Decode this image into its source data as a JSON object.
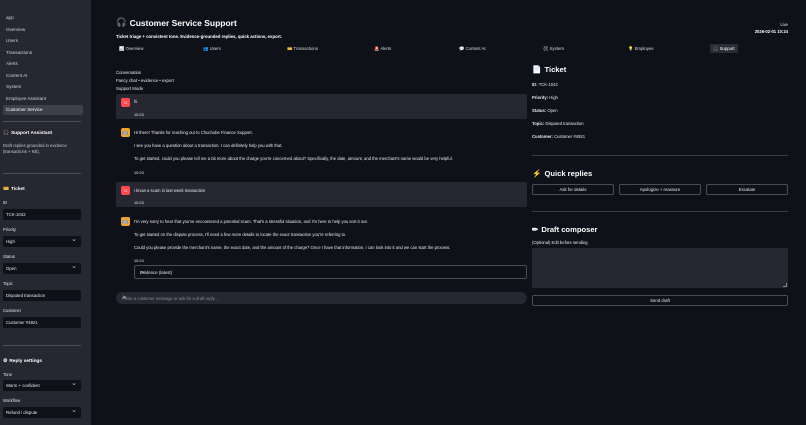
{
  "sidebar": {
    "nav": [
      "app",
      "Overview",
      "Users",
      "Transactions",
      "Alerts",
      "Content AI",
      "System",
      "Employee Assistant",
      "Customer Service"
    ],
    "active_index": 8,
    "assistant": {
      "title": "Support Assistant",
      "icon": "headset-icon",
      "desc_line1": "Draft replies grounded in evidence",
      "desc_line2": "(transactions + KB)."
    },
    "ticket": {
      "title": "Ticket",
      "icon": "ticket-icon",
      "id_label": "ID",
      "id_value": "TCK-1042",
      "priority_label": "Priority",
      "priority_value": "High",
      "status_label": "Status",
      "status_value": "Open",
      "topic_label": "Topic",
      "topic_value": "Disputed transaction",
      "customer_label": "Customer",
      "customer_value": "Customer #4921"
    },
    "reply": {
      "title": "Reply settings",
      "icon": "gear-icon",
      "tone_label": "Tone",
      "tone_value": "Warm + confident",
      "workflow_label": "Workflow",
      "workflow_value": "Refund / dispute"
    }
  },
  "header": {
    "title": "Customer Service Support",
    "title_icon": "headset-icon",
    "subtitle": "Ticket triage + consistent tone. Evidence-grounded replies, quick actions, export.",
    "user": "Live",
    "datetime": "2026-02-01 10:24"
  },
  "tabs": [
    {
      "label": "Overview",
      "icon": "chart-icon"
    },
    {
      "label": "Users",
      "icon": "users-icon"
    },
    {
      "label": "Transactions",
      "icon": "card-icon"
    },
    {
      "label": "Alerts",
      "icon": "alert-icon"
    },
    {
      "label": "Content AI",
      "icon": "chat-icon"
    },
    {
      "label": "System",
      "icon": "wrench-icon"
    },
    {
      "label": "Employee",
      "icon": "bulb-icon"
    },
    {
      "label": "Support",
      "icon": "headset-icon"
    }
  ],
  "conversation": {
    "title": "Conversation",
    "subtitle": "Fancy chat • evidence • export",
    "mode": "Support Mode",
    "messages": [
      {
        "role": "user",
        "lines": [
          "hi"
        ],
        "time": "10:23"
      },
      {
        "role": "bot",
        "lines": [
          "Hi there! Thanks for reaching out to Chuchube Finance Support.",
          "I see you have a question about a transaction. I can definitely help you with that.",
          "To get started, could you please tell me a bit more about the charge you're concerned about? Specifically, the date, amount, and the merchant's name would be very helpful."
        ],
        "time": "10:23"
      },
      {
        "role": "user",
        "lines": [
          "i know a scam in last week transaction"
        ],
        "time": "10:23"
      },
      {
        "role": "bot",
        "lines": [
          "I'm very sorry to hear that you've encountered a potential scam. That's a stressful situation, and I'm here to help you sort it out.",
          "To get started on the dispute process, I'll need a few more details to locate the exact transaction you're referring to.",
          "Could you please provide the merchant's name, the exact date, and the amount of the charge? Once I have that information, I can look into it and we can start the process."
        ],
        "time": "10:24"
      }
    ],
    "evidence_label": "Evidence (latest)",
    "input_placeholder": "Paste a customer message or ask for a draft reply..."
  },
  "ticket_panel": {
    "title": "Ticket",
    "id": "TCK-1042",
    "priority": "High",
    "status": "Open",
    "topic": "Disputed transaction",
    "customer": "Customer #4921",
    "labels": {
      "id": "ID:",
      "priority": "Priority:",
      "status": "Status:",
      "topic": "Topic:",
      "customer": "Customer:"
    }
  },
  "quick_replies": {
    "title": "Quick replies",
    "icon": "lightning-icon",
    "buttons": [
      "Ask for details",
      "Apologize + reassure",
      "Escalate"
    ]
  },
  "draft": {
    "title": "Draft composer",
    "icon": "pencil-icon",
    "label": "(Optional) Edit before sending",
    "send_label": "Send draft"
  },
  "colors": {
    "bg": "#0e1117",
    "sidebar": "#262730",
    "user_avatar": "#ff4b4b",
    "bot_avatar": "#f0a52a"
  }
}
